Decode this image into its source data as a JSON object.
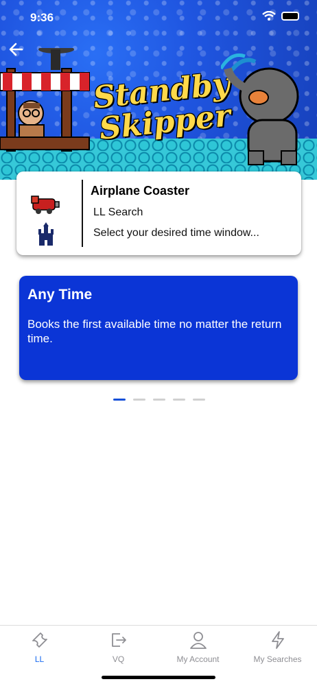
{
  "status_bar": {
    "time": "9:36"
  },
  "banner": {
    "title_line1": "Standby",
    "title_line2": "Skipper"
  },
  "info_card": {
    "ride_name": "Airplane Coaster",
    "search_type": "LL Search",
    "instruction": "Select your desired time window..."
  },
  "option_card": {
    "title": "Any Time",
    "description": "Books the first available time no matter the return time."
  },
  "pager": {
    "pages": 5,
    "active_index": 0
  },
  "tabbar": {
    "tabs": [
      {
        "label": "LL",
        "icon": "ticket-icon",
        "active": true
      },
      {
        "label": "VQ",
        "icon": "exit-icon",
        "active": false
      },
      {
        "label": "My Account",
        "icon": "person-icon",
        "active": false
      },
      {
        "label": "My Searches",
        "icon": "bolt-icon",
        "active": false
      }
    ]
  },
  "colors": {
    "accent": "#1a6bf0",
    "option_card_bg": "#0b35d6",
    "banner_bg": "#1f55e0",
    "title_yellow": "#ffd94a"
  }
}
